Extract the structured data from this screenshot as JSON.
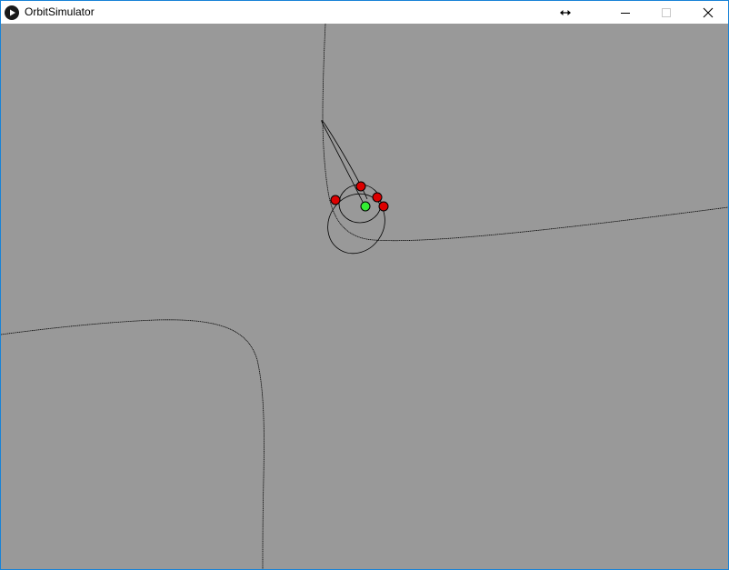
{
  "window": {
    "title": "OrbitSimulator",
    "accent_color": "#1883d7"
  },
  "titlebar": {
    "app_icon": "play-circle-icon",
    "buttons": [
      {
        "icon": "resize-horizontal-icon"
      },
      {
        "icon": "minimize-icon"
      },
      {
        "icon": "maximize-icon"
      },
      {
        "icon": "close-icon"
      }
    ]
  },
  "simulation": {
    "background_color": "#999999",
    "trail_color": "#000000",
    "sun": {
      "color": "#33ee33"
    },
    "planets": {
      "count": 4,
      "color": "#dd0000"
    }
  }
}
